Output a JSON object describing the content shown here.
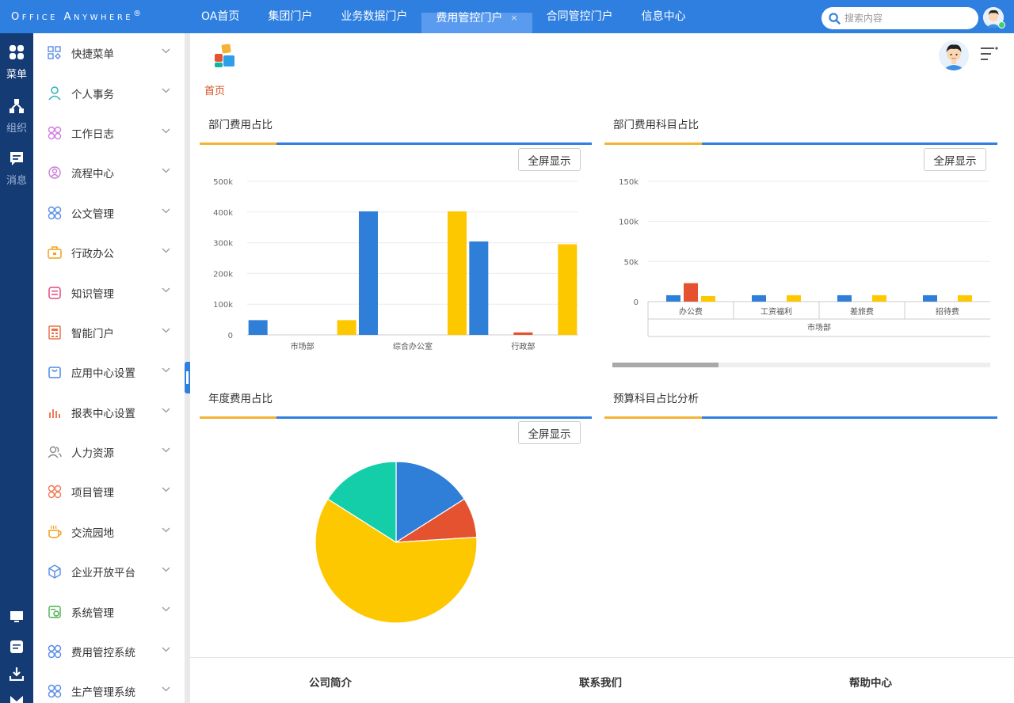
{
  "brand": {
    "logo_text": "Office Anywhere",
    "logo_mark": "®"
  },
  "topnav": {
    "tabs": [
      {
        "label": "OA首页",
        "active": false
      },
      {
        "label": "集团门户",
        "active": false
      },
      {
        "label": "业务数据门户",
        "active": false
      },
      {
        "label": "费用管控门户",
        "active": true,
        "close": "×"
      },
      {
        "label": "合同管控门户",
        "active": false
      },
      {
        "label": "信息中心",
        "active": false
      }
    ],
    "search_placeholder": "搜索内容"
  },
  "rail": {
    "items": [
      {
        "label": "菜单",
        "icon": "grid-icon",
        "active": true
      },
      {
        "label": "组织",
        "icon": "org-icon",
        "active": false
      },
      {
        "label": "消息",
        "icon": "message-icon",
        "active": false
      }
    ],
    "bottom_icons": [
      "monitor-icon",
      "note-icon",
      "download-icon",
      "mail-icon"
    ]
  },
  "sidemenu": {
    "items": [
      {
        "label": "快捷菜单",
        "icon": "shortcut-icon",
        "color": "#5a8de6"
      },
      {
        "label": "个人事务",
        "icon": "person-icon",
        "color": "#2fb3b7"
      },
      {
        "label": "工作日志",
        "icon": "log-icon",
        "color": "#d27ae0"
      },
      {
        "label": "流程中心",
        "icon": "flow-icon",
        "color": "#c97ed6"
      },
      {
        "label": "公文管理",
        "icon": "document-icon",
        "color": "#5a8de6"
      },
      {
        "label": "行政办公",
        "icon": "briefcase-icon",
        "color": "#f0a21f"
      },
      {
        "label": "知识管理",
        "icon": "book-icon",
        "color": "#e24b7d"
      },
      {
        "label": "智能门户",
        "icon": "portal-icon",
        "color": "#e8754a"
      },
      {
        "label": "应用中心设置",
        "icon": "bag-icon",
        "color": "#4a8be0"
      },
      {
        "label": "报表中心设置",
        "icon": "report-icon",
        "color": "#f07b57"
      },
      {
        "label": "人力资源",
        "icon": "people-icon",
        "color": "#8b8b8b"
      },
      {
        "label": "项目管理",
        "icon": "project-icon",
        "color": "#f07b57"
      },
      {
        "label": "交流园地",
        "icon": "coffee-icon",
        "color": "#f0a21f"
      },
      {
        "label": "企业开放平台",
        "icon": "cube-icon",
        "color": "#5a8de6"
      },
      {
        "label": "系统管理",
        "icon": "settings-icon",
        "color": "#4caf50"
      },
      {
        "label": "费用管控系统",
        "icon": "expense-icon",
        "color": "#5a8de6"
      },
      {
        "label": "生产管理系统",
        "icon": "production-icon",
        "color": "#5a8de6"
      }
    ]
  },
  "main": {
    "breadcrumb": "首页",
    "fullscreen_label": "全屏显示"
  },
  "colors": {
    "blue": "#2f7ed8",
    "red": "#e4522f",
    "yellow": "#fec800",
    "green": "#13cea8",
    "accent": "#2e7fe0",
    "rail": "#143b73"
  },
  "chart_data": [
    {
      "panel_title": "部门费用占比",
      "type": "bar",
      "categories": [
        "市场部",
        "综合办公室",
        "行政部"
      ],
      "series": [
        {
          "values": [
            48000,
            402000,
            304000
          ],
          "color": "#2f7ed8"
        },
        {
          "values": [
            0,
            0,
            8000
          ],
          "color": "#e4522f"
        },
        {
          "values": [
            48000,
            402000,
            295000
          ],
          "color": "#fec800"
        }
      ],
      "y_ticks": [
        "0",
        "100k",
        "200k",
        "300k",
        "400k",
        "500k"
      ],
      "ylim": [
        0,
        500000
      ],
      "grid": true
    },
    {
      "panel_title": "部门费用科目占比",
      "type": "bar",
      "group_label": "市场部",
      "categories": [
        "办公费",
        "工资福利",
        "差旅费",
        "招待费"
      ],
      "series": [
        {
          "values": [
            8000,
            8000,
            8000,
            8000
          ],
          "color": "#2f7ed8"
        },
        {
          "values": [
            23000,
            0,
            0,
            0
          ],
          "color": "#e4522f"
        },
        {
          "values": [
            7000,
            8000,
            8000,
            8000
          ],
          "color": "#fec800"
        }
      ],
      "y_ticks": [
        "0",
        "50k",
        "100k",
        "150k"
      ],
      "ylim": [
        0,
        150000
      ],
      "grid": true
    },
    {
      "panel_title": "年度费用占比",
      "type": "pie",
      "values": [
        16,
        8,
        60,
        16
      ],
      "colors": [
        "#2f7ed8",
        "#e4522f",
        "#fec800",
        "#13cea8"
      ]
    },
    {
      "panel_title": "预算科目占比分析",
      "type": "table",
      "values": []
    }
  ],
  "footer": {
    "links": [
      "公司简介",
      "联系我们",
      "帮助中心"
    ]
  }
}
